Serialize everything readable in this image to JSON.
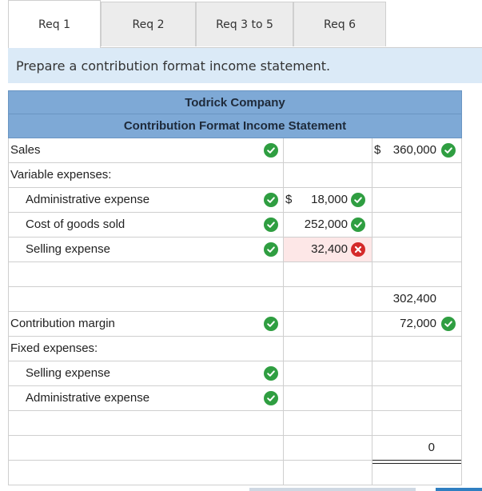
{
  "tabs": [
    {
      "label": "Req 1",
      "active": true
    },
    {
      "label": "Req 2",
      "active": false
    },
    {
      "label": "Req 3 to 5",
      "active": false
    },
    {
      "label": "Req 6",
      "active": false
    }
  ],
  "prompt": "Prepare a contribution format income statement.",
  "statement": {
    "company": "Todrick Company",
    "title": "Contribution Format Income Statement",
    "rows": [
      {
        "label": "Sales",
        "a_currency": "",
        "a_value": "",
        "b_currency": "$",
        "b_value": "360,000",
        "b_status": "correct",
        "label_status": "correct"
      },
      {
        "label": "Variable expenses:"
      },
      {
        "label": "Administrative expense",
        "a_currency": "$",
        "a_value": "18,000",
        "a_status": "correct",
        "label_status": "correct"
      },
      {
        "label": "Cost of goods sold",
        "a_value": "252,000",
        "a_status": "correct",
        "label_status": "correct"
      },
      {
        "label": "Selling expense",
        "a_value": "32,400",
        "a_status": "incorrect",
        "label_status": "correct"
      },
      {
        "label": ""
      },
      {
        "label": "",
        "b_value": "302,400"
      },
      {
        "label": "Contribution margin",
        "b_value": "72,000",
        "b_status": "correct",
        "label_status": "correct"
      },
      {
        "label": "Fixed expenses:"
      },
      {
        "label": "Selling expense",
        "label_status": "correct"
      },
      {
        "label": "Administrative expense",
        "label_status": "correct"
      },
      {
        "label": ""
      },
      {
        "label": "",
        "b_value": "0"
      },
      {
        "label": ""
      }
    ]
  },
  "colors": {
    "header": "#7ea9d6",
    "prompt_bg": "#dbeaf7",
    "correct": "#2f9e41",
    "incorrect": "#d42a2a"
  }
}
